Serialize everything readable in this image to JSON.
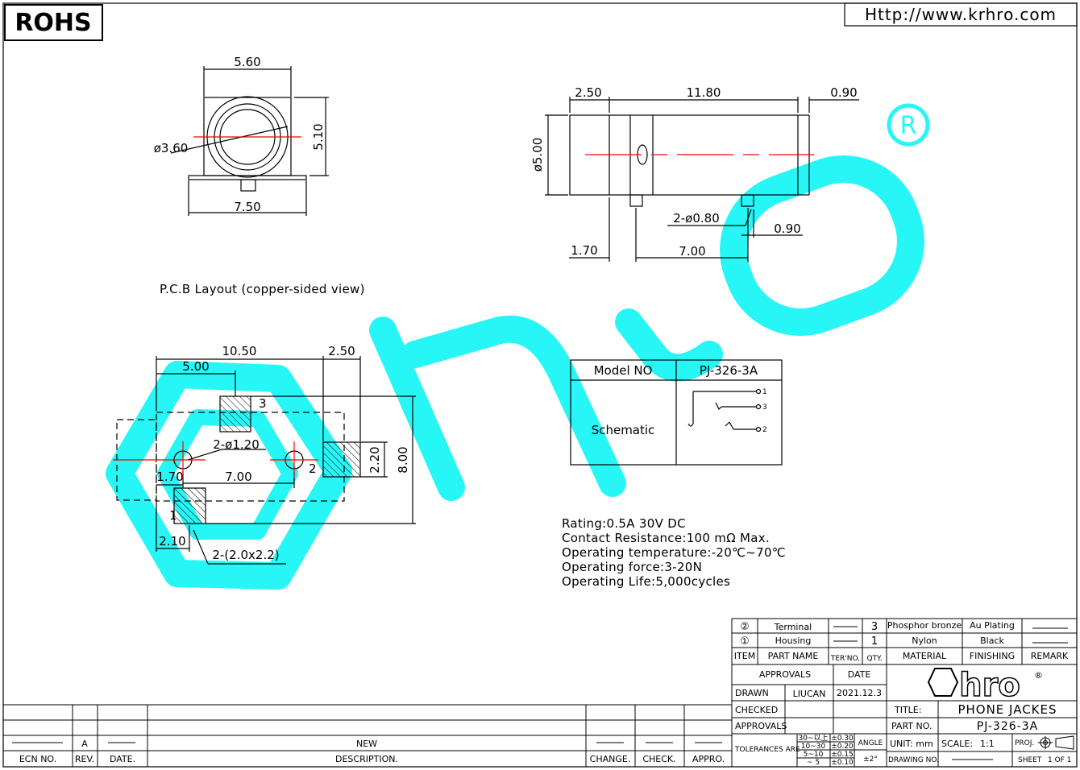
{
  "header": {
    "rohs_label": "ROHS",
    "url": "Http://www.krhro.com"
  },
  "front_view": {
    "width_top": "5.60",
    "diameter": "ø3.60",
    "height": "5.10",
    "width_bottom": "7.50"
  },
  "side_view": {
    "dim_left": "2.50",
    "dim_length": "11.80",
    "dim_right": "0.90",
    "dim_diameter": "ø5.00",
    "dim_pins": "2-ø0.80",
    "dim_pin_offset": "0.90",
    "dim_front_to_pin": "1.70",
    "dim_pin_spacing": "7.00"
  },
  "pcb_caption": "P.C.B Layout (copper-sided view)",
  "pcb": {
    "dim_total": "10.50",
    "dim_half": "5.00",
    "dim_tail": "2.50",
    "dim_holes": "2-ø1.20",
    "dim_height": "8.00",
    "dim_pad": "2.20",
    "dim_front": "1.70",
    "dim_spacing": "7.00",
    "dim_pad_offset": "2.10",
    "dim_pad_size": "2-(2.0x2.2)",
    "pin1": "1",
    "pin2": "2",
    "pin3": "3"
  },
  "model_table": {
    "model_label": "Model NO",
    "model_value": "PJ-326-3A",
    "schematic_label": "Schematic",
    "pins": [
      "1",
      "3",
      "2"
    ]
  },
  "specs": [
    "Rating:0.5A 30V DC",
    "Contact Resistance:100 mΩ Max.",
    "Operating temperature:-20℃~70℃",
    "Operating force:3-20N",
    "Operating Life:5,000cycles"
  ],
  "bom": {
    "rows": [
      {
        "num": "②",
        "name": "Terminal",
        "qty": "3",
        "material": "Phosphor bronze",
        "finish": "Au Plating"
      },
      {
        "num": "①",
        "name": "Housing",
        "qty": "1",
        "material": "Nylon",
        "finish": "Black"
      }
    ],
    "headers": {
      "item": "ITEM",
      "part_name": "PART NAME",
      "ter_no": "TER'NO.",
      "qty": "QTY.",
      "material": "MATERIAL",
      "finishing": "FINISHING",
      "remark": "REMARK"
    }
  },
  "title_block": {
    "approvals": "APPROVALS",
    "date": "DATE",
    "drawn": "DRAWN",
    "drawn_by": "LIUCAN",
    "drawn_date": "2021.12.3",
    "checked": "CHECKED",
    "approvals2": "APPROVALS",
    "title_label": "TITLE:",
    "title_value": "PHONE JACKES",
    "part_no_label": "PART NO.",
    "part_no_value": "PJ-326-3A",
    "tolerances_label": "TOLERANCES ARE",
    "tolerance_rows": [
      {
        "range": "30~以上",
        "tol": "±0.30"
      },
      {
        "range": "10~30",
        "tol": "±0.20"
      },
      {
        "range": "5~10",
        "tol": "±0.15"
      },
      {
        "range": "~ 5",
        "tol": "±0.10"
      }
    ],
    "angle_label": "ANGLE",
    "angle_value": "±2°",
    "unit": "UNIT: mm",
    "scale": "SCALE:",
    "scale_value": "1:1",
    "proj": "PROJ.",
    "drawing_no": "DRAWING NO.",
    "sheet": "SHEET",
    "sheet_value": "1 OF 1",
    "logo_text": "hro",
    "logo_mark": "®"
  },
  "revision_block": {
    "rev_value": "A",
    "desc_value": "NEW",
    "ecn_no": "ECN NO.",
    "rev": "REV.",
    "date": "DATE.",
    "description": "DESCRIPTION.",
    "change": "CHANGE.",
    "check": "CHECK.",
    "appro": "APPRO."
  },
  "watermark": {
    "registered_mark": "R",
    "color": "#00f5f5"
  },
  "colors": {
    "centerline": "#ff0000",
    "line": "#000000"
  }
}
